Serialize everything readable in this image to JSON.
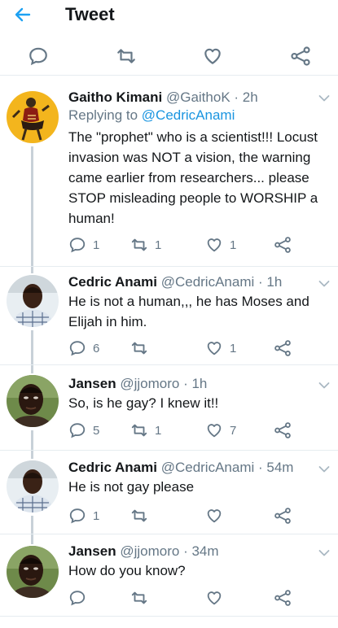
{
  "header": {
    "title": "Tweet"
  },
  "tweets": [
    {
      "name": "Gaitho Kimani",
      "handle": "@GaithoK",
      "time": "· 2h",
      "replying_label": "Replying to",
      "replying_mention": "@CedricAnami",
      "lines": [
        "The \"prophet\" who is a scientist!!! Locust",
        "invasion was NOT a vision, the warning",
        "came earlier from researchers... please",
        "STOP misleading people to WORSHIP a",
        "human!"
      ],
      "replies": "1",
      "retweets": "1",
      "likes": "1"
    },
    {
      "name": "Cedric Anami",
      "handle": "@CedricAnami",
      "time": "· 1h",
      "lines": [
        "He is not a human,,, he has Moses and",
        "Elijah in him."
      ],
      "replies": "6",
      "retweets": "",
      "likes": "1"
    },
    {
      "name": "Jansen",
      "handle": "@jjomoro",
      "time": "· 1h",
      "lines": [
        "So, is he gay? I knew it!!"
      ],
      "replies": "5",
      "retweets": "1",
      "likes": "7"
    },
    {
      "name": "Cedric Anami",
      "handle": "@CedricAnami",
      "time": "· 54m",
      "lines": [
        "He is not gay please"
      ],
      "replies": "1",
      "retweets": "",
      "likes": ""
    },
    {
      "name": "Jansen",
      "handle": "@jjomoro",
      "time": "· 34m",
      "lines": [
        "How do you know?"
      ],
      "replies": "",
      "retweets": "",
      "likes": ""
    }
  ],
  "colors": {
    "accent": "#1da1f2",
    "icon_gray": "#657786",
    "text": "#14171a"
  }
}
